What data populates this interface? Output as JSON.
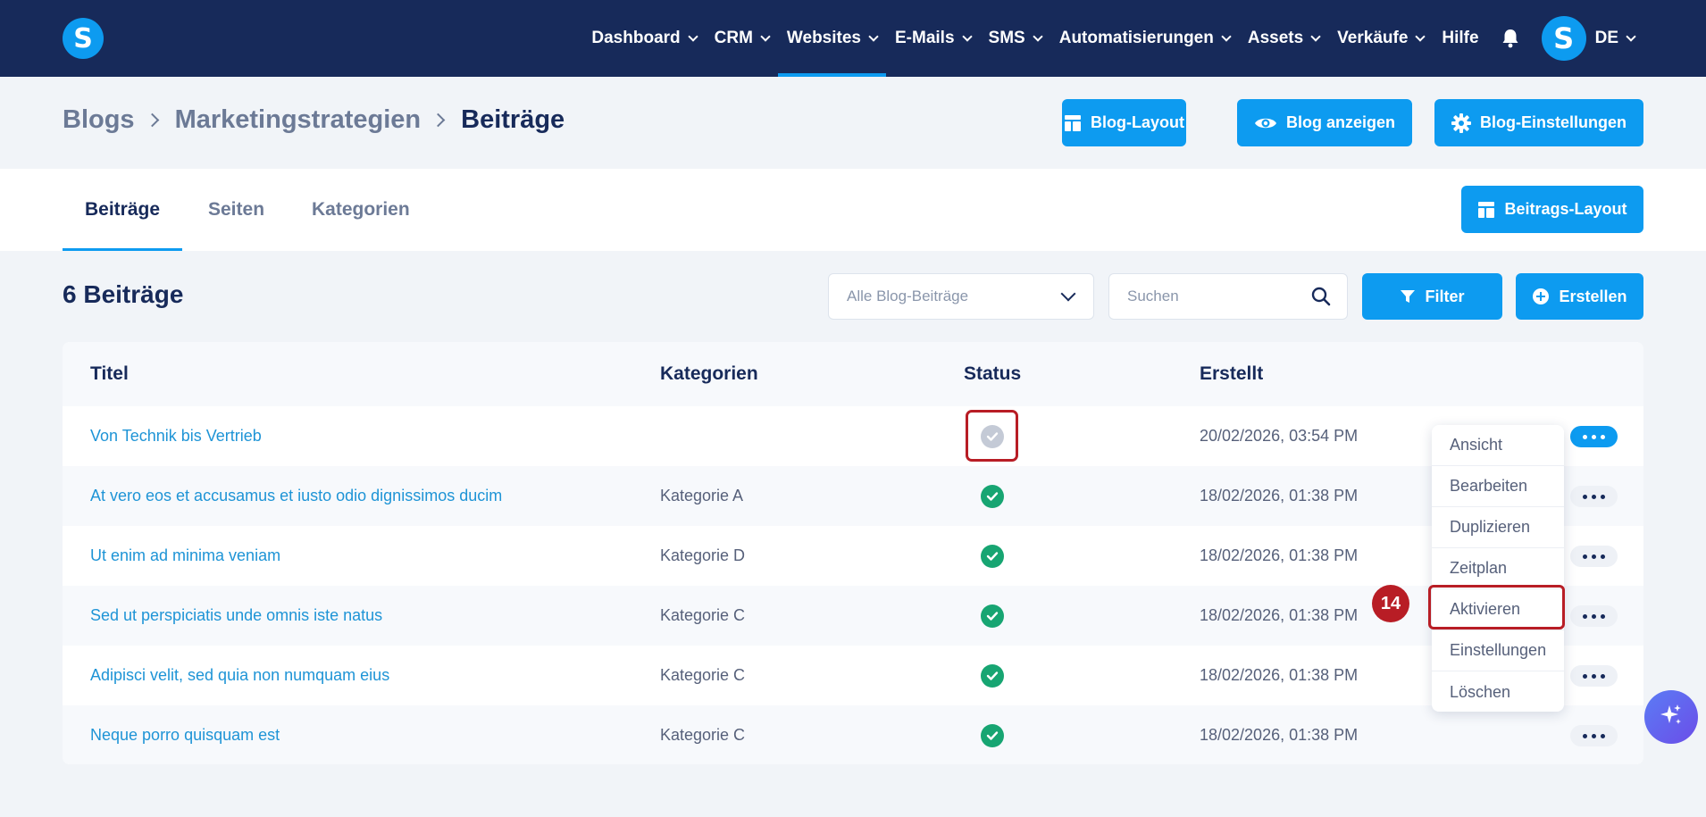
{
  "app": {
    "logo_letter": "S"
  },
  "nav": {
    "items": [
      {
        "label": "Dashboard",
        "has_menu": true
      },
      {
        "label": "CRM",
        "has_menu": true
      },
      {
        "label": "Websites",
        "has_menu": true,
        "active": true
      },
      {
        "label": "E-Mails",
        "has_menu": true
      },
      {
        "label": "SMS",
        "has_menu": true
      },
      {
        "label": "Automatisierungen",
        "has_menu": true
      },
      {
        "label": "Assets",
        "has_menu": true
      },
      {
        "label": "Verkäufe",
        "has_menu": true
      },
      {
        "label": "Hilfe",
        "has_menu": false
      }
    ],
    "avatar_letter": "S",
    "language": "DE"
  },
  "breadcrumb": [
    "Blogs",
    "Marketingstrategien",
    "Beiträge"
  ],
  "header_buttons": {
    "blog_layout": "Blog-Layout",
    "blog_view": "Blog anzeigen",
    "blog_settings": "Blog-Einstellungen"
  },
  "tabs": [
    {
      "label": "Beiträge",
      "active": true
    },
    {
      "label": "Seiten"
    },
    {
      "label": "Kategorien"
    }
  ],
  "post_layout_button": "Beitrags-Layout",
  "list": {
    "count_title": "6 Beiträge",
    "filter_select": "Alle Blog-Beiträge",
    "search_placeholder": "Suchen",
    "filter_button": "Filter",
    "create_button": "Erstellen"
  },
  "table": {
    "headers": {
      "title": "Titel",
      "categories": "Kategorien",
      "status": "Status",
      "created": "Erstellt"
    },
    "rows": [
      {
        "title": "Von Technik bis Vertrieb",
        "category": "",
        "status": "inactive",
        "created": "20/02/2026, 03:54 PM"
      },
      {
        "title": "At vero eos et accusamus et iusto odio dignissimos ducim",
        "category": "Kategorie A",
        "status": "active",
        "created": "18/02/2026, 01:38 PM"
      },
      {
        "title": "Ut enim ad minima veniam",
        "category": "Kategorie D",
        "status": "active",
        "created": "18/02/2026, 01:38 PM"
      },
      {
        "title": "Sed ut perspiciatis unde omnis iste natus",
        "category": "Kategorie C",
        "status": "active",
        "created": "18/02/2026, 01:38 PM"
      },
      {
        "title": "Adipisci velit, sed quia non numquam eius",
        "category": "Kategorie C",
        "status": "active",
        "created": "18/02/2026, 01:38 PM"
      },
      {
        "title": "Neque porro quisquam est",
        "category": "Kategorie C",
        "status": "active",
        "created": "18/02/2026, 01:38 PM"
      }
    ]
  },
  "row_menu": {
    "items": [
      "Ansicht",
      "Bearbeiten",
      "Duplizieren",
      "Zeitplan",
      "Aktivieren",
      "Einstellungen",
      "Löschen"
    ],
    "highlighted": "Aktivieren"
  },
  "step_badge": "14",
  "colors": {
    "nav_bg": "#172a5a",
    "accent": "#0d9bf0",
    "success": "#17a572",
    "highlight": "#b81d25"
  }
}
